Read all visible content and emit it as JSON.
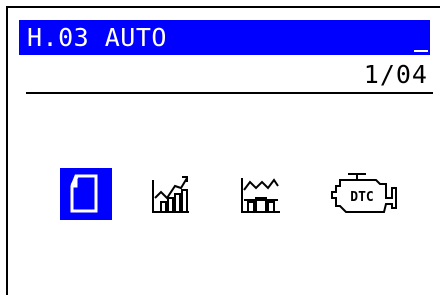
{
  "header": {
    "title": "H.03 AUTO",
    "page_indicator": "1/04",
    "title_bg_color": "#0000ff",
    "title_fg_color": "#ffffff"
  },
  "menu": {
    "items": [
      {
        "icon": "document-icon",
        "selected": true
      },
      {
        "icon": "live-data-graph-icon",
        "selected": false
      },
      {
        "icon": "freeze-frame-graph-icon",
        "selected": false
      },
      {
        "icon": "dtc-engine-icon",
        "selected": false,
        "label": "DTC"
      }
    ],
    "selected_color": "#0000ff"
  }
}
